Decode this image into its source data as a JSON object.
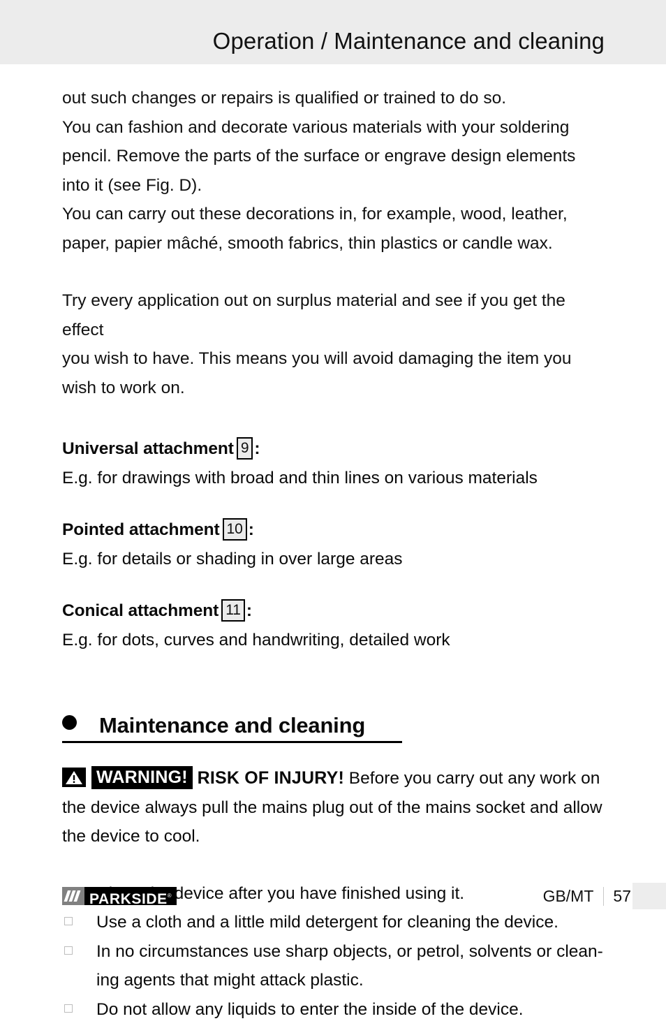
{
  "header": {
    "title": "Operation / Maintenance and cleaning",
    "band_color": "#ececec"
  },
  "body": {
    "paragraph_1": "out such changes or repairs is qualified or trained to do so.\nYou can fashion and decorate various materials with your soldering pencil. Remove the parts of the surface or engrave design elements into it (see Fig. D).\nYou can carry out these decorations in, for example, wood, leather, paper, papier mâché, smooth fabrics, thin plastics or candle wax.",
    "paragraph_1_lines": [
      "out such changes or repairs is qualified or trained to do so.",
      "You can fashion and decorate various materials with your soldering",
      "pencil. Remove the parts of the surface or engrave design elements",
      "into it (see Fig. D).",
      "You can carry out these decorations in, for example, wood, leather,",
      "paper, papier mâché, smooth fabrics, thin plastics or candle wax."
    ],
    "paragraph_2": "Try every application out on surplus material and see if you get the effect you wish to have. This means you will avoid damaging the item you wish to work on.",
    "paragraph_2_lines": [
      "Try every application out on surplus material and see if you get the effect",
      "you wish to have. This means you will avoid damaging the item you",
      "wish to work on."
    ]
  },
  "attachments": [
    {
      "title": "Universal attachment",
      "ref_number": "9",
      "colon": ":",
      "description": "E.g. for drawings with broad and thin lines on various materials"
    },
    {
      "title": "Pointed attachment",
      "ref_number": "10",
      "colon": ":",
      "description": "E.g. for details or shading in over large areas"
    },
    {
      "title": "Conical attachment",
      "ref_number": "11",
      "colon": ":",
      "description": "E.g. for dots, curves and handwriting, detailed work"
    }
  ],
  "section": {
    "heading": "Maintenance and cleaning",
    "bullet_icon": "filled-circle-bullet"
  },
  "warning": {
    "icon_name": "warning-triangle-icon",
    "tag_label": "WARNING!",
    "risk_label": "RISK OF INJURY!",
    "text": " Before you carry out any work on the device always pull the mains plug out of the mains socket and allow the device to cool.",
    "tag_bg": "#000000",
    "tag_fg": "#ffffff"
  },
  "checklist": {
    "bullet_icon": "empty-square-bullet",
    "items": [
      "Clean the device after you have finished using it.",
      "Use a cloth and a little mild detergent for cleaning the device.",
      "In no circumstances use sharp objects, or petrol, solvents or clean-ing agents that might attack plastic.",
      "Do not allow any liquids to enter the inside of the device."
    ],
    "items_lines": [
      [
        "Clean the device after you have finished using it."
      ],
      [
        "Use a cloth and a little mild detergent for cleaning the device."
      ],
      [
        "In no circumstances use sharp objects, or petrol, solvents or clean-",
        "ing agents that might attack plastic."
      ],
      [
        "Do not allow any liquids to enter the inside of the device."
      ]
    ]
  },
  "footer": {
    "brand_name": "PARKSIDE",
    "brand_trademark": "®",
    "brand_mark_icon": "triple-slash-icon",
    "language_code": "GB/MT",
    "page_number": "57"
  }
}
